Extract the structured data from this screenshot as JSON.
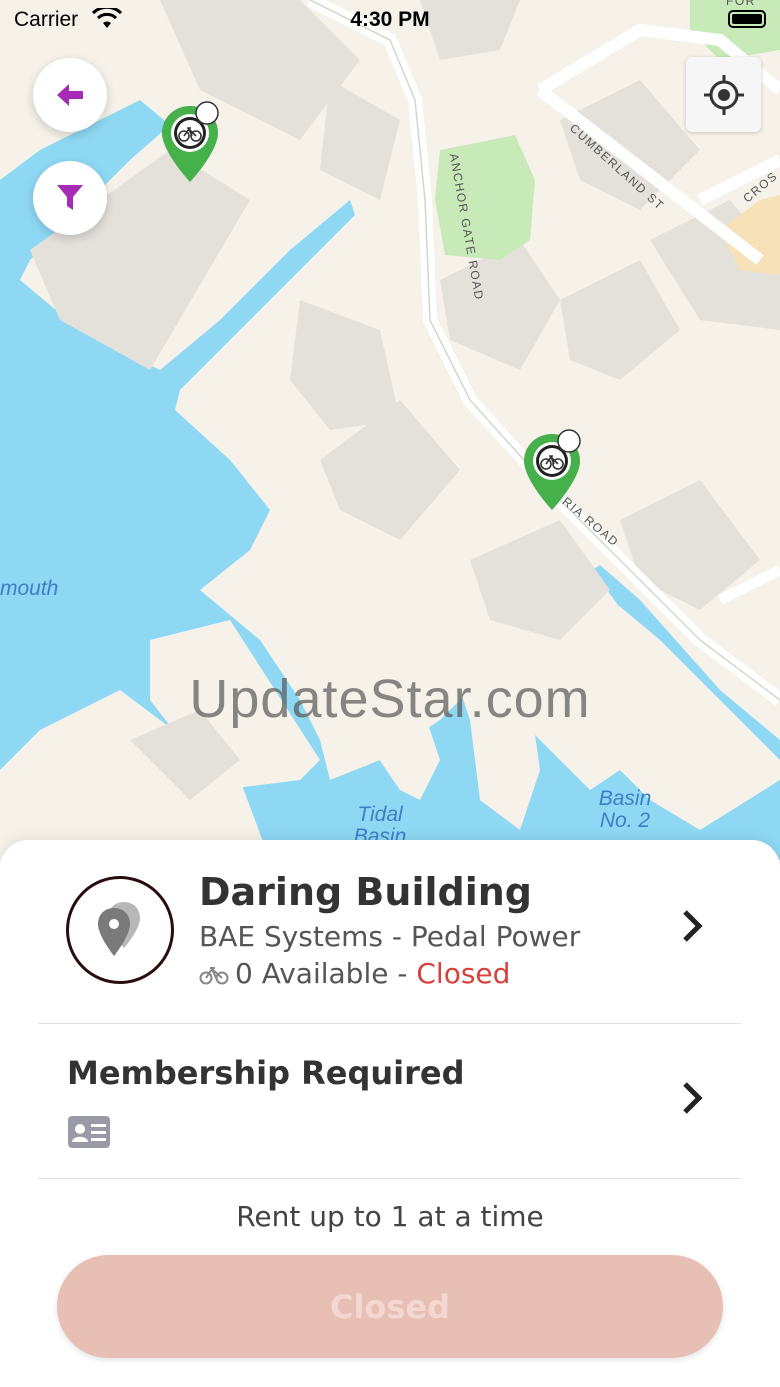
{
  "status_bar": {
    "carrier": "Carrier",
    "time": "4:30 PM"
  },
  "map": {
    "watermark": "UpdateStar.com",
    "water_labels": [
      "mouth",
      "Tidal Basin",
      "Basin No. 2"
    ],
    "street_labels": [
      "ANCHOR GATE ROAD",
      "CUMBERLAND ST",
      "CROS",
      "RIA ROAD",
      "FOR"
    ],
    "colors": {
      "land": "#f6f2ea",
      "water": "#8fd8f4",
      "building": "#e4e1db",
      "park": "#c8eab8",
      "pin": "#46b04a"
    },
    "icons": [
      "back-arrow-icon",
      "filter-icon",
      "locate-icon",
      "bike-station-pin-icon"
    ]
  },
  "station": {
    "name": "Daring Building",
    "operator": "BAE Systems - Pedal Power",
    "available": "0 Available -",
    "status": "Closed"
  },
  "membership": {
    "title": "Membership Required"
  },
  "rent_info": "Rent up to 1 at a time",
  "action_button": "Closed",
  "accent_colors": {
    "primary": "#a62cb5",
    "closed_red": "#d9403a",
    "disabled_button": "#e7bfb4"
  }
}
